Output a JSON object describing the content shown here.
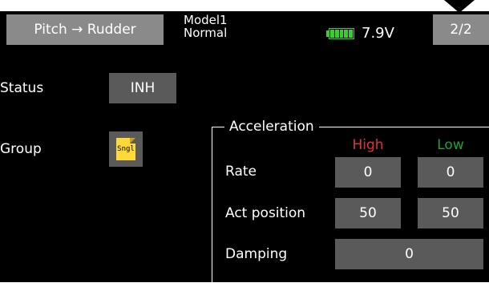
{
  "header": {
    "title": "Pitch → Rudder",
    "model_name": "Model1",
    "condition": "Normal",
    "voltage": "7.9V",
    "battery_level": 1.0,
    "page": "2/2"
  },
  "status": {
    "label": "Status",
    "value": "INH"
  },
  "group": {
    "label": "Group",
    "icon": "Sngl"
  },
  "acceleration": {
    "title": "Acceleration",
    "high_label": "High",
    "low_label": "Low",
    "rate_label": "Rate",
    "rate_high": "0",
    "rate_low": "0",
    "act_position_label": "Act position",
    "act_position_high": "50",
    "act_position_low": "50",
    "damping_label": "Damping",
    "damping_value": "0"
  },
  "colors": {
    "button_gray": "#8a8a8a",
    "value_gray": "#5a5a5a",
    "high": "#e0343a",
    "low": "#1aa337",
    "battery": "#35d12b",
    "group_icon": "#ffd83a"
  }
}
